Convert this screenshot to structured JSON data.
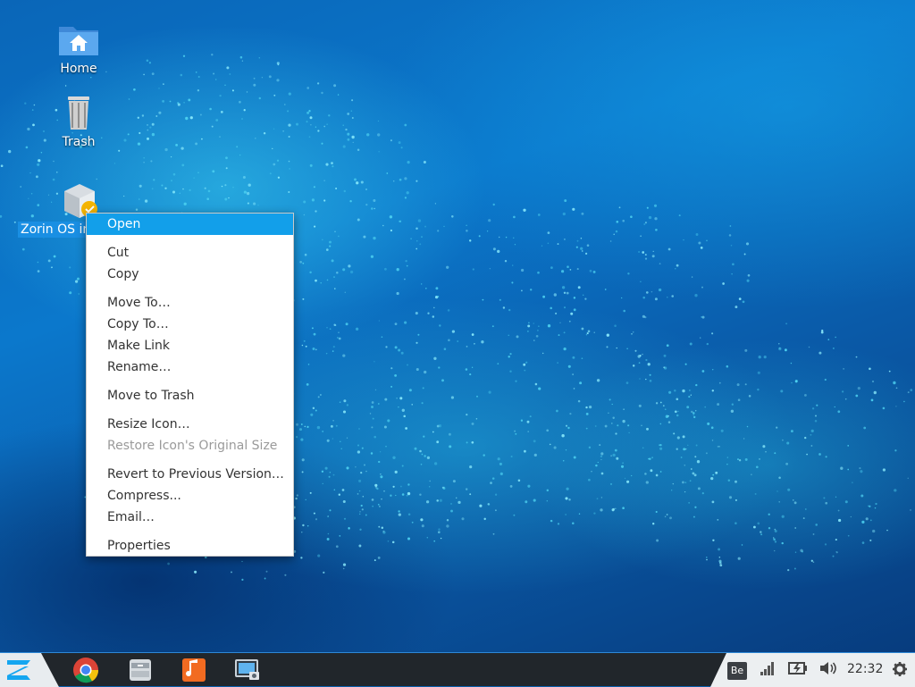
{
  "desktop": {
    "icons": [
      {
        "label": "Home"
      },
      {
        "label": "Trash"
      },
      {
        "label": "Zorin OS in"
      }
    ]
  },
  "context_menu": {
    "items": [
      {
        "label": "Open",
        "state": "highlighted"
      },
      {
        "label": "Cut"
      },
      {
        "label": "Copy"
      },
      {
        "label": "Move To…"
      },
      {
        "label": "Copy To…"
      },
      {
        "label": "Make Link"
      },
      {
        "label": "Rename…"
      },
      {
        "label": "Move to Trash"
      },
      {
        "label": "Resize Icon…"
      },
      {
        "label": "Restore Icon's Original Size",
        "state": "disabled"
      },
      {
        "label": "Revert to Previous Version…"
      },
      {
        "label": "Compress..."
      },
      {
        "label": "Email…"
      },
      {
        "label": "Properties"
      }
    ]
  },
  "taskbar": {
    "apps": [
      "zorin-menu-icon",
      "chrome-icon",
      "file-manager-icon",
      "music-player-icon",
      "screenshot-icon"
    ],
    "tray": {
      "keyboard_layout": "Be",
      "clock": "22:32"
    }
  },
  "colors": {
    "menu_highlight": "#129fea",
    "selection": "#1a8fe3",
    "taskbar": "#21262b",
    "taskbar_light": "#eceff1"
  }
}
